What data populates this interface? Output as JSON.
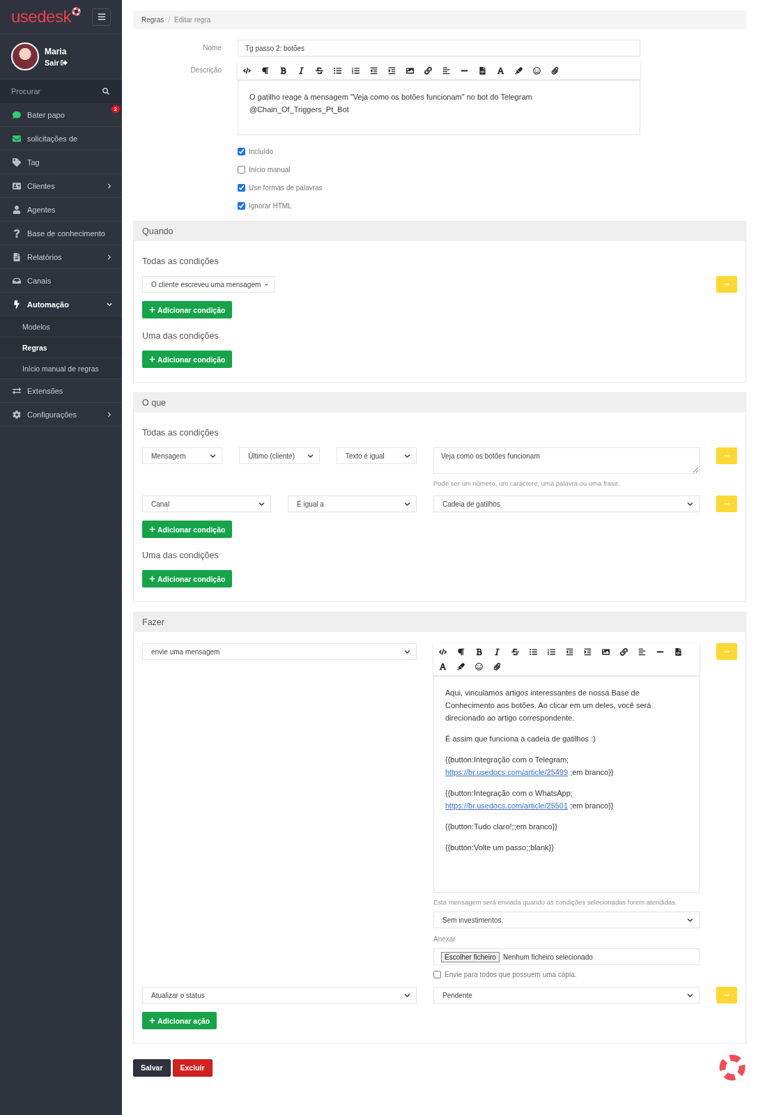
{
  "sidebar": {
    "logo": "usedesk",
    "user": {
      "name": "Maria",
      "logout": "Sair"
    },
    "search": {
      "placeholder": "Procurar"
    },
    "items": [
      {
        "label": "Bater papo",
        "badge": "2",
        "has_submenu": false,
        "expanded": false
      },
      {
        "label": "solicitações de",
        "has_submenu": false,
        "expanded": false
      },
      {
        "label": "Tag",
        "has_submenu": false,
        "expanded": false
      },
      {
        "label": "Clientes",
        "has_submenu": true,
        "expanded": false
      },
      {
        "label": "Agentes",
        "has_submenu": false,
        "expanded": false
      },
      {
        "label": "Base de conhecimento",
        "has_submenu": false,
        "expanded": false
      },
      {
        "label": "Relatórios",
        "has_submenu": true,
        "expanded": false
      },
      {
        "label": "Canais",
        "has_submenu": false,
        "expanded": false
      },
      {
        "label": "Automação",
        "has_submenu": true,
        "expanded": true,
        "children": [
          {
            "label": "Modelos",
            "selected": false
          },
          {
            "label": "Regras",
            "selected": true
          },
          {
            "label": "Início manual de regras",
            "selected": false
          }
        ]
      },
      {
        "label": "Extensões",
        "has_submenu": false,
        "expanded": false
      },
      {
        "label": "Configurações",
        "has_submenu": true,
        "expanded": false
      }
    ]
  },
  "breadcrumb": {
    "items": [
      "Regras",
      "Editar regra"
    ],
    "separator": "/"
  },
  "form": {
    "name": {
      "label": "Nome",
      "value": "Tg passo 2: botões"
    },
    "description": {
      "label": "Descrição",
      "lines": [
        "O gatilho reage à mensagem \"Veja como os botões funcionam\" no bot do Telegram",
        "@Chain_Of_Triggers_Pt_Bot"
      ]
    },
    "options": [
      {
        "label": "Incluído",
        "checked": true
      },
      {
        "label": "Início manual",
        "checked": false
      },
      {
        "label": "Use formas de palavras",
        "checked": true
      },
      {
        "label": "Ignorar HTML",
        "checked": true
      }
    ]
  },
  "sections": [
    {
      "title": "Quando",
      "groups": [
        {
          "title": "Todas as condições",
          "rows": [
            {
              "left": [
                {
                  "value": "O cliente escreveu uma mensagem"
                }
              ]
            }
          ],
          "add_button": "Adicionar condição"
        },
        {
          "title": "Uma das condições",
          "add_button": "Adicionar condição"
        }
      ]
    },
    {
      "title": "O que",
      "groups": [
        {
          "title": "Todas as condições",
          "rows": [
            {
              "left": [
                {
                  "value": "Mensagem"
                },
                {
                  "value": "Último (cliente)"
                },
                {
                  "value": "Texto é igual"
                }
              ],
              "right": {
                "kind": "textarea",
                "value": "Veja como os botões funcionam",
                "hint": "Pode ser um número, um caractere, uma palavra ou uma frase."
              }
            },
            {
              "left": [
                {
                  "value": "Canal"
                },
                {
                  "value": "É igual a"
                }
              ],
              "right": {
                "kind": "select",
                "value": "Cadeia de gatilhos"
              }
            }
          ],
          "add_button": "Adicionar condição"
        },
        {
          "title": "Uma das condições",
          "add_button": "Adicionar condição"
        }
      ]
    },
    {
      "title": "Fazer",
      "groups": [
        {
          "rows": [
            {
              "left": [
                {
                  "value": "envie uma mensagem"
                }
              ],
              "right": {
                "kind": "message",
                "paragraphs": [
                  {
                    "text": "Aqui, vinculamos artigos interessantes de nossa Base de Conhecimento aos botões. Ao clicar em um deles, você será direcionado ao artigo correspondente."
                  },
                  {
                    "text": "É assim que funciona a cadeia de gatilhos :)"
                  },
                  {
                    "text": "{{button:Integração com o Telegram;",
                    "link": "https://br.usedocs.com/article/25499",
                    "after": " ;em branco}}"
                  },
                  {
                    "text": "{{button:Integração com o WhatsApp;",
                    "link": "https://br.usedocs.com/article/25501",
                    "after": " ;em branco}}"
                  },
                  {
                    "text": "{{button:Tudo claro!;;em branco}}"
                  },
                  {
                    "text": "{{button:Volte um passo;;blank}}"
                  }
                ],
                "hint": "Esta mensagem será enviada quando as condições selecionadas forem atendidas.",
                "select": "Sem investimentos",
                "attach_label": "Anexar",
                "file_button": "Escolher ficheiro",
                "file_status": "Nenhum ficheiro selecionado",
                "copy_option": {
                  "label": "Envie para todos que possuem uma cópia.",
                  "checked": false
                }
              }
            },
            {
              "left": [
                {
                  "value": "Atualizar o status"
                }
              ],
              "right": {
                "kind": "select",
                "value": "Pendente"
              }
            }
          ],
          "add_button": "Adicionar ação"
        }
      ]
    }
  ],
  "footer": {
    "save": "Salvar",
    "delete": "Excluir"
  }
}
